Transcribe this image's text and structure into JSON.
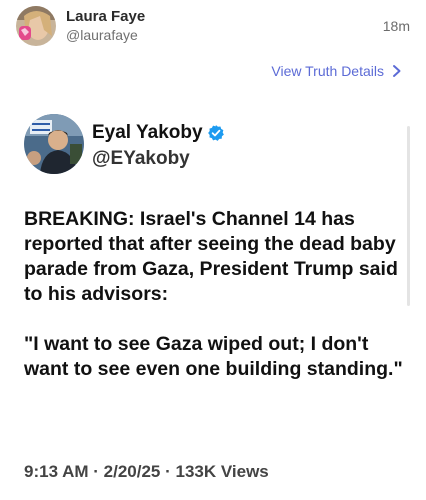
{
  "post": {
    "author_name": "Laura Faye",
    "author_handle": "@laurafaye",
    "time_ago": "18m",
    "details_link": "View Truth Details"
  },
  "quoted_post": {
    "author_name": "Eyal Yakoby",
    "author_handle": "@EYakoby",
    "verified": true,
    "body_paragraphs": [
      "BREAKING: Israel's Channel 14 has reported that after seeing the dead baby parade from Gaza, President Trump said to his advisors:",
      "\"I want to see Gaza wiped out; I don't want to see even one building standing.\""
    ],
    "meta": "9:13 AM · 2/20/25 · 133K Views"
  },
  "colors": {
    "link": "#5c6bd6",
    "verified_badge": "#1d9bf0"
  },
  "icons": {
    "details_chevron": "chevron-right-icon",
    "verified": "verified-badge-icon"
  }
}
